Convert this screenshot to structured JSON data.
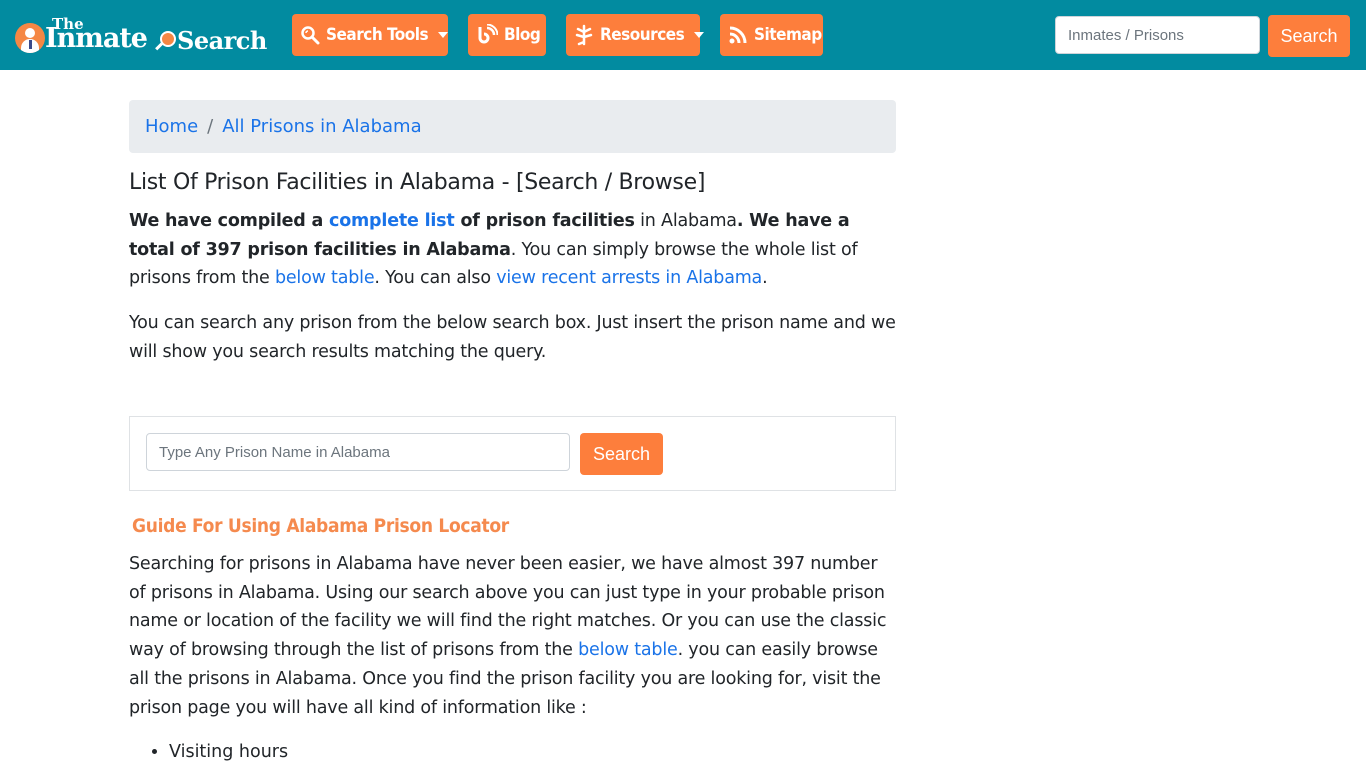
{
  "colors": {
    "navbar_bg": "#028ba0",
    "accent_orange": "#fd7e3c",
    "link_blue": "#1a73e8",
    "guide_title": "#f58a4e",
    "breadcrumb_bg": "#e9ecef"
  },
  "logo": {
    "the": "The",
    "inmate": "Inmate",
    "search": "Search"
  },
  "nav": {
    "items": [
      {
        "label": "Search Tools",
        "icon": "search-tools-icon",
        "dropdown": true
      },
      {
        "label": "Blog",
        "icon": "blog-icon",
        "dropdown": false
      },
      {
        "label": "Resources",
        "icon": "leaf-icon",
        "dropdown": true
      },
      {
        "label": "Sitemap",
        "icon": "rss-icon",
        "dropdown": false
      }
    ],
    "search_placeholder": "Inmates / Prisons",
    "search_button": "Search"
  },
  "breadcrumb": {
    "items": [
      "Home",
      "All Prisons in Alabama"
    ],
    "separator": "/"
  },
  "main": {
    "title": "List Of Prison Facilities in Alabama - [Search / Browse]",
    "intro": {
      "s1": "We have compiled a ",
      "link1": "complete list",
      "s2": " of prison facilities",
      "s3": " in Alabama",
      "s4": ". We have a total of 397 prison facilities in Alabama",
      "s5": ". You can simply browse the whole list of prisons from the ",
      "link2": "below table",
      "s6": ". You can also ",
      "link3": "view recent arrests in Alabama",
      "s7": "."
    },
    "search_info": "You can search any prison from the below search box. Just insert the prison name and we will show you search results matching the query.",
    "prison_search": {
      "placeholder": "Type Any Prison Name in Alabama",
      "button": "Search"
    },
    "guide": {
      "title": "Guide For Using Alabama Prison Locator",
      "s1": "Searching for prisons in Alabama have never been easier, we have almost 397 number of prisons in Alabama. Using our search above you can just type in your probable prison name or location of the facility we will find the right matches. Or you can use the classic way of browsing through the list of prisons from the ",
      "link": "below table",
      "s2": ". you can easily browse all the prisons in Alabama. Once you find the prison facility you are looking for, visit the prison page you will have all kind of information like :",
      "bullets": [
        "Visiting hours"
      ]
    }
  }
}
